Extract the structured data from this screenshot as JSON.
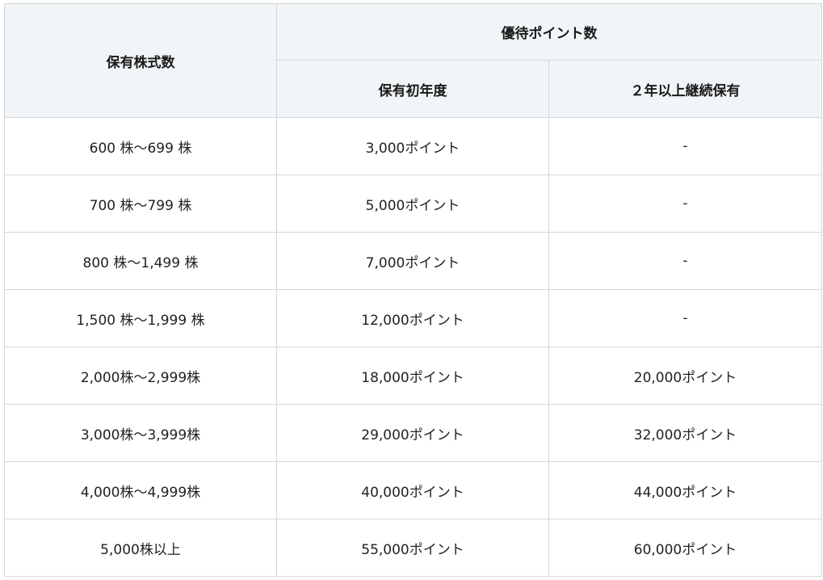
{
  "table": {
    "header": {
      "shares": "保有株式数",
      "points_group": "優待ポイント数",
      "first_year": "保有初年度",
      "two_years": "２年以上継続保有"
    },
    "rows": [
      {
        "shares": "600 株～699 株",
        "first_year": "3,000ポイント",
        "two_years": "-"
      },
      {
        "shares": "700 株～799 株",
        "first_year": "5,000ポイント",
        "two_years": "-"
      },
      {
        "shares": "800 株～1,499 株",
        "first_year": "7,000ポイント",
        "two_years": "-"
      },
      {
        "shares": "1,500 株～1,999 株",
        "first_year": "12,000ポイント",
        "two_years": "-"
      },
      {
        "shares": "2,000株～2,999株",
        "first_year": "18,000ポイント",
        "two_years": "20,000ポイント"
      },
      {
        "shares": "3,000株～3,999株",
        "first_year": "29,000ポイント",
        "two_years": "32,000ポイント"
      },
      {
        "shares": "4,000株～4,999株",
        "first_year": "40,000ポイント",
        "two_years": "44,000ポイント"
      },
      {
        "shares": "5,000株以上",
        "first_year": "55,000ポイント",
        "two_years": "60,000ポイント"
      }
    ]
  }
}
